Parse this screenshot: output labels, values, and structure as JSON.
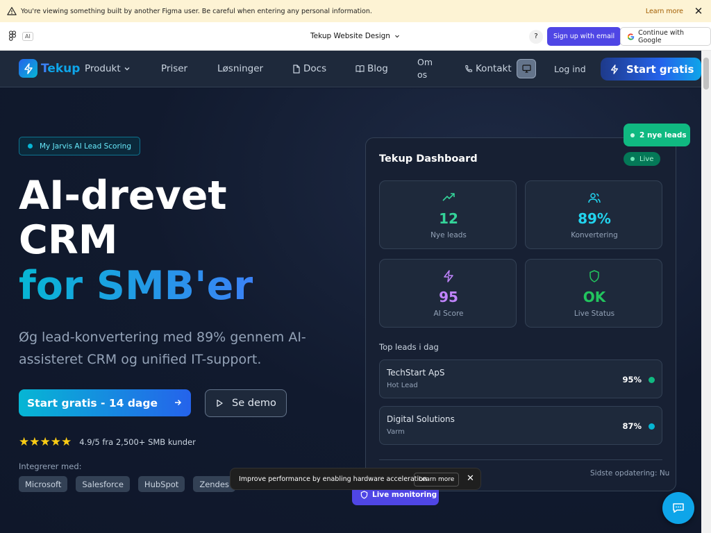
{
  "banner": {
    "text": "You're viewing something built by another Figma user. Be careful when entering any personal information.",
    "learn_more": "Learn more"
  },
  "figma": {
    "ai_label": "AI",
    "file_title": "Tekup Website Design",
    "help": "?",
    "signup": "Sign up with email",
    "google": "Continue with Google"
  },
  "nav": {
    "logo_t": "T",
    "logo_rest": "ekup",
    "items": [
      "Produkt",
      "Priser",
      "Løsninger",
      "Docs",
      "Blog",
      "Om os",
      "Kontakt"
    ],
    "login": "Log ind",
    "start": "Start gratis"
  },
  "hero": {
    "badge": "My Jarvis AI Lead Scoring",
    "title_line1": "AI-drevet",
    "title_line2": "CRM",
    "title_line3": "for SMB'er",
    "subtitle": "Øg lead-konvertering med 89% gennem AI-assisteret CRM og unified IT-support.",
    "cta_primary": "Start gratis - 14 dage",
    "cta_secondary": "Se demo",
    "rating_stars": 5,
    "rating_text": "4.9/5 fra 2,500+ SMB kunder",
    "integrations_label": "Integrerer med:",
    "integrations": [
      "Microsoft",
      "Salesforce",
      "HubSpot",
      "Zendes"
    ]
  },
  "dashboard": {
    "title": "Tekup Dashboard",
    "live": "Live",
    "new_leads_badge": "2 nye leads",
    "stats": [
      {
        "value": "12",
        "label": "Nye leads",
        "color": "#34d399"
      },
      {
        "value": "89%",
        "label": "Konvertering",
        "color": "#22d3ee"
      },
      {
        "value": "95",
        "label": "AI Score",
        "color": "#c084fc"
      },
      {
        "value": "OK",
        "label": "Live Status",
        "color": "#22c55e"
      }
    ],
    "top_leads_label": "Top leads i dag",
    "leads": [
      {
        "name": "TechStart ApS",
        "tag": "Hot Lead",
        "pct": "95%",
        "dot": "#10b981"
      },
      {
        "name": "Digital Solutions",
        "tag": "Varm",
        "pct": "87%",
        "dot": "#06b6d4"
      }
    ],
    "updated": "Sidste opdatering: Nu"
  },
  "toast": {
    "text": "Improve performance by enabling hardware acceleration",
    "learn": "Learn more"
  },
  "monitoring": "Live monitoring"
}
